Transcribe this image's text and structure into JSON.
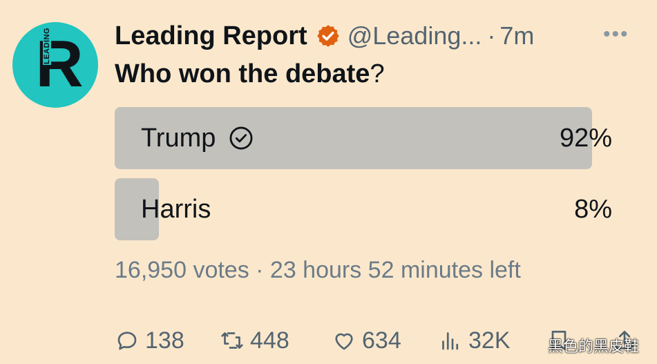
{
  "account": {
    "name": "Leading Report",
    "handle": "@Leading...",
    "separator": "·",
    "time": "7m",
    "avatar_letter": "R",
    "avatar_word": "LEADING"
  },
  "more_label": "•••",
  "question": {
    "text": "Who won the debate",
    "mark": "?"
  },
  "poll": {
    "options": [
      {
        "label": "Trump",
        "percent_label": "92%",
        "percent": 92,
        "winner": true
      },
      {
        "label": "Harris",
        "percent_label": "8%",
        "percent": 8,
        "winner": false
      }
    ],
    "summary": "16,950 votes · 23 hours 52 minutes left"
  },
  "actions": {
    "replies": "138",
    "reposts": "448",
    "likes": "634",
    "views": "32K"
  },
  "watermark": "黑色的黑皮鞋",
  "colors": {
    "background": "#fbe8cc",
    "avatar": "#22c5c0",
    "bar": "#c3c1bb",
    "verified": "#e0610f"
  },
  "icons": [
    "verified-badge-icon",
    "check-circle-icon",
    "reply-icon",
    "repost-icon",
    "like-icon",
    "views-icon",
    "bookmark-icon",
    "share-icon"
  ]
}
